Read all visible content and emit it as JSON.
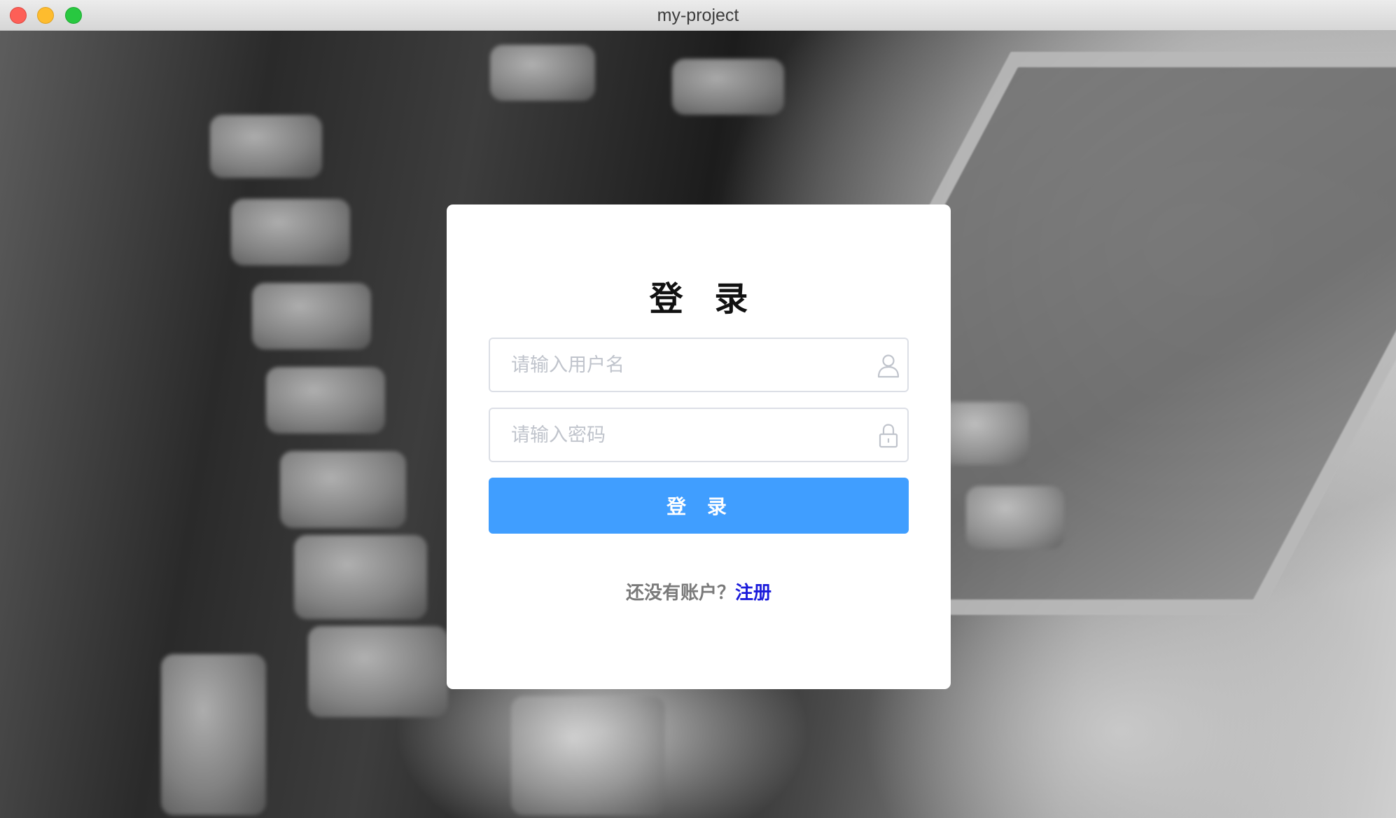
{
  "window": {
    "title": "my-project"
  },
  "background": {
    "description_icon": "typewriter-keyboard-photo"
  },
  "login": {
    "title": "登 录",
    "username_placeholder": "请输入用户名",
    "username_value": "",
    "username_icon": "user-icon",
    "password_placeholder": "请输入密码",
    "password_value": "",
    "password_icon": "lock-icon",
    "submit_label": "登 录",
    "signup_prompt": "还没有账户？",
    "signup_link": "注册"
  },
  "colors": {
    "primary": "#409eff",
    "link": "#1a1adb",
    "input_border": "#dcdfe6",
    "placeholder": "#c0c4cc"
  }
}
